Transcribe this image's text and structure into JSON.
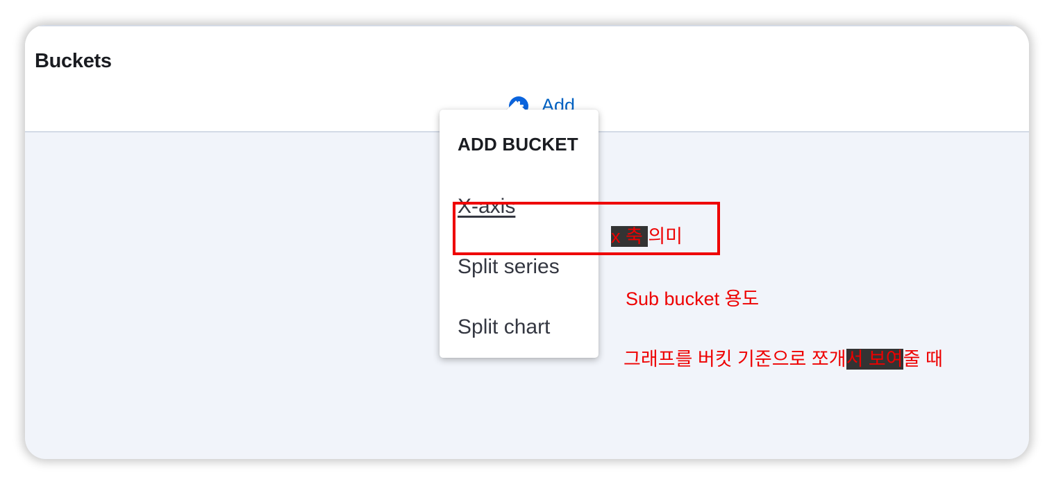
{
  "panel": {
    "title": "Buckets",
    "add_label": "Add"
  },
  "popover": {
    "title": "ADD BUCKET",
    "items": [
      {
        "label": "X-axis"
      },
      {
        "label": "Split series"
      },
      {
        "label": "Split chart"
      }
    ]
  },
  "annotations": {
    "note1_hl": "x 축 ",
    "note1_rest": "의미",
    "note2": "Sub bucket 용도",
    "note3_a": "그래프를 버킷 기준으로 쪼개",
    "note3_hl": "서 보여",
    "note3_b": "줄 때",
    "color": "#ee0000"
  },
  "colors": {
    "accent": "#0b64dd",
    "link": "#0061c2",
    "background": "#f1f4fa"
  }
}
